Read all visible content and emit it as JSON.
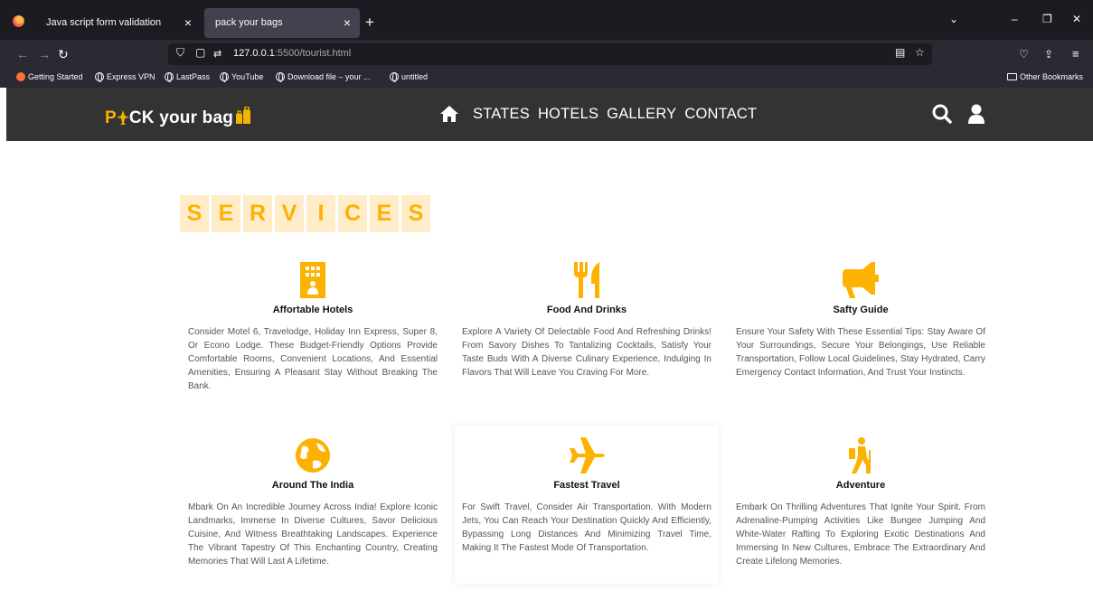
{
  "browser": {
    "tabs": [
      {
        "title": "Java script form validation"
      },
      {
        "title": "pack your bags"
      }
    ],
    "url_host": "127.0.0.1",
    "url_path": ":5500/tourist.html",
    "bookmarks": [
      "Getting Started",
      "Express VPN",
      "LastPass",
      "YouTube",
      "Download file – your ...",
      "untitled"
    ],
    "other_bookmarks": "Other Bookmarks"
  },
  "site": {
    "logo": {
      "pa": "P",
      "ck_text": "CK your bag"
    },
    "nav": [
      "STATES",
      "HOTELS",
      "GALLERY",
      "CONTACT"
    ],
    "services_letters": [
      "S",
      "E",
      "R",
      "V",
      "I",
      "C",
      "E",
      "S"
    ],
    "accent": "#fdb100",
    "cards": [
      {
        "icon": "hotel-icon",
        "title": "Affortable Hotels",
        "text": "Consider Motel 6, Travelodge, Holiday Inn Express, Super 8, Or Econo Lodge. These Budget-Friendly Options Provide Comfortable Rooms, Convenient Locations, And Essential Amenities, Ensuring A Pleasant Stay Without Breaking The Bank."
      },
      {
        "icon": "utensils-icon",
        "title": "Food And Drinks",
        "text": "Explore A Variety Of Delectable Food And Refreshing Drinks! From Savory Dishes To Tantalizing Cocktails, Satisfy Your Taste Buds With A Diverse Culinary Experience, Indulging In Flavors That Will Leave You Craving For More."
      },
      {
        "icon": "bullhorn-icon",
        "title": "Safty Guide",
        "text": "Ensure Your Safety With These Essential Tips: Stay Aware Of Your Surroundings, Secure Your Belongings, Use Reliable Transportation, Follow Local Guidelines, Stay Hydrated, Carry Emergency Contact Information, And Trust Your Instincts."
      },
      {
        "icon": "globe-icon",
        "title": "Around The India",
        "text": "Mbark On An Incredible Journey Across India! Explore Iconic Landmarks, Immerse In Diverse Cultures, Savor Delicious Cuisine, And Witness Breathtaking Landscapes. Experience The Vibrant Tapestry Of This Enchanting Country, Creating Memories That Will Last A Lifetime."
      },
      {
        "icon": "plane-icon",
        "title": "Fastest Travel",
        "text": "For Swift Travel, Consider Air Transportation. With Modern Jets, You Can Reach Your Destination Quickly And Efficiently, Bypassing Long Distances And Minimizing Travel Time, Making It The Fastest Mode Of Transportation."
      },
      {
        "icon": "hiking-icon",
        "title": "Adventure",
        "text": "Embark On Thrilling Adventures That Ignite Your Spirit. From Adrenaline-Pumping Activities Like Bungee Jumping And White-Water Rafting To Exploring Exotic Destinations And Immersing In New Cultures, Embrace The Extraordinary And Create Lifelong Memories."
      }
    ]
  }
}
